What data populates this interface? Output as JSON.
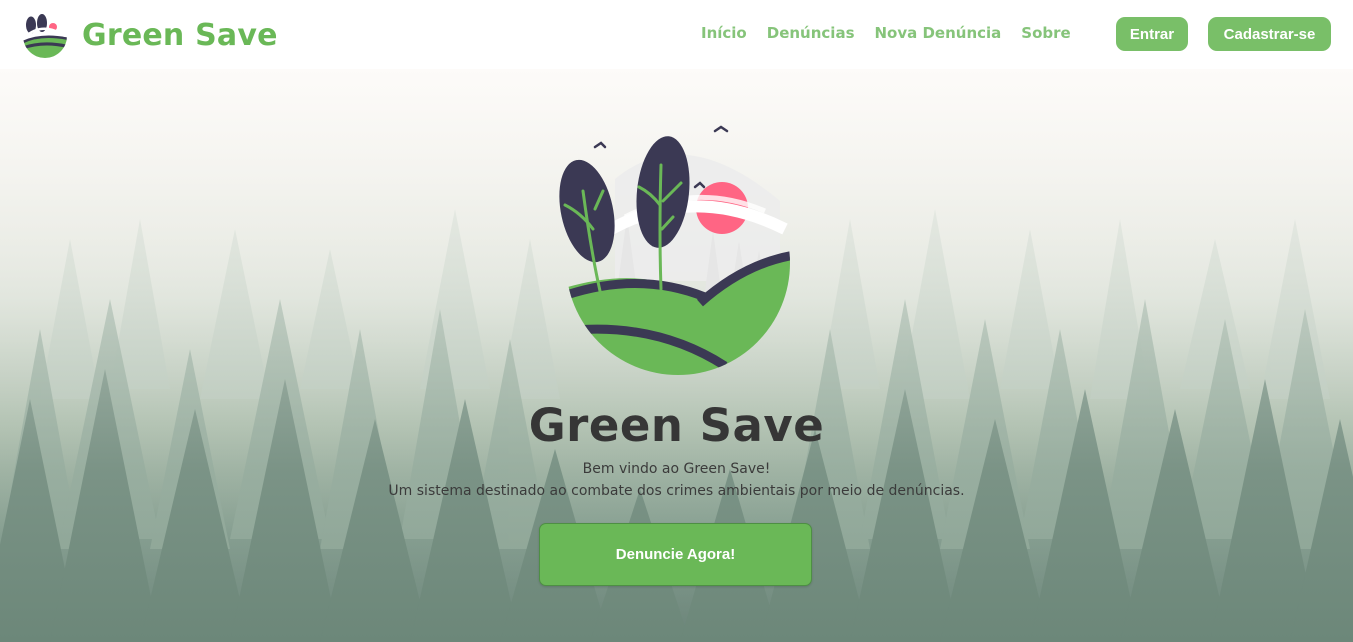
{
  "brand": {
    "name": "Green Save",
    "logo_icon": "green-save-logo-icon"
  },
  "nav": {
    "links": [
      {
        "label": "Início"
      },
      {
        "label": "Denúncias"
      },
      {
        "label": "Nova Denúncia"
      },
      {
        "label": "Sobre"
      }
    ],
    "login_label": "Entrar",
    "signup_label": "Cadastrar-se"
  },
  "hero": {
    "title": "Green Save",
    "line1": "Bem vindo ao Green Save!",
    "line2": "Um sistema destinado ao combate dos crimes ambientais por meio de denúncias.",
    "cta_label": "Denuncie Agora!",
    "illustration_icon": "green-save-illustration-icon"
  },
  "colors": {
    "brand_green": "#6ab857",
    "nav_link": "#86c47a",
    "dark_purple": "#3b3954",
    "sun_pink": "#ff6584",
    "title_text": "#363636"
  }
}
